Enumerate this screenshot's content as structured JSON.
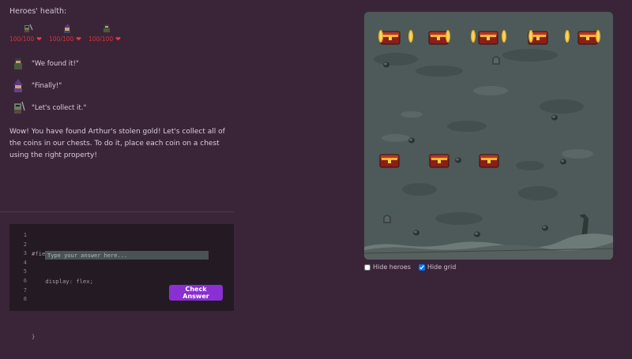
{
  "health": {
    "title": "Heroes' health:",
    "heroes": [
      {
        "name": "hero-one",
        "hp": "100/100"
      },
      {
        "name": "hero-two",
        "hp": "100/100"
      },
      {
        "name": "hero-three",
        "hp": "100/100"
      }
    ]
  },
  "dialog": [
    {
      "text": "\"We found it!\""
    },
    {
      "text": "\"Finally!\""
    },
    {
      "text": "\"Let's collect it.\""
    }
  ],
  "story": "Wow! You have found Arthur's stolen gold! Let's collect all of the coins in our chests. To do it, place each coin on a chest using the right property!",
  "editor": {
    "line_numbers": [
      "1",
      "2",
      "3",
      "4",
      "5",
      "6",
      "7",
      "8"
    ],
    "line1": "#field {",
    "line2": "    display: flex;",
    "line4": "}",
    "placeholder": "Type your answer here...",
    "button": "Check Answer"
  },
  "options": {
    "hide_heroes": "Hide heroes",
    "hide_grid": "Hide grid",
    "hide_heroes_checked": false,
    "hide_grid_checked": true
  },
  "colors": {
    "background": "#3a2538",
    "accent": "#8a2fd1",
    "heart": "#e03a42",
    "board": "#4d5a59"
  }
}
